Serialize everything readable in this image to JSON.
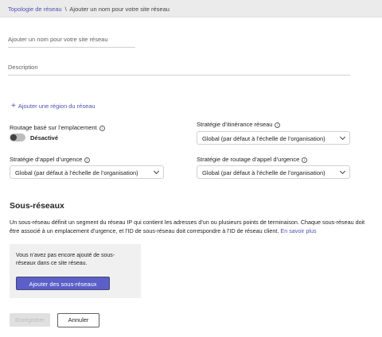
{
  "breadcrumb": {
    "parent": "Topologie de réseau",
    "separator": "\\",
    "current": "Ajouter un nom pour votre site réseau"
  },
  "form": {
    "name_placeholder": "Ajouter un nom pour votre site réseau",
    "description_placeholder": "Description",
    "add_region_label": "Ajouter une région du réseau",
    "location_routing": {
      "label": "Routage basé sur l’emplacement",
      "toggle_state": "Désactivé",
      "enabled": false
    },
    "roaming_policy": {
      "label": "Stratégie d’itinérance réseau",
      "value": "Global (par défaut à l’échelle de l’organisation)"
    },
    "emergency_calling_policy": {
      "label": "Stratégie d’appel d’urgence",
      "value": "Global (par défaut à l’échelle de l’organisation)"
    },
    "emergency_routing_policy": {
      "label": "Stratégie de routage d’appel d’urgence",
      "value": "Global (par défaut à l’échelle de l’organisation)"
    }
  },
  "subnets": {
    "title": "Sous-réseaux",
    "description": "Un sous-réseau définit un segment du réseau IP qui contient les adresses d’un ou plusieurs points de terminaison. Chaque sous-réseau doit être associé à un emplacement d’urgence, et l’ID de sous-réseau doit correspondre à l’ID de réseau client.",
    "learn_more": "En savoir plus",
    "empty_text": "Vous n’avez pas encore ajouté de sous-réseaux dans ce site réseau.",
    "add_button": "Ajouter des sous-réseaux"
  },
  "actions": {
    "save": "Enregistrer",
    "cancel": "Annuler"
  },
  "colors": {
    "accent": "#5b5fc7",
    "link": "#4f52b2",
    "breadcrumb_bg": "#ebebeb"
  }
}
